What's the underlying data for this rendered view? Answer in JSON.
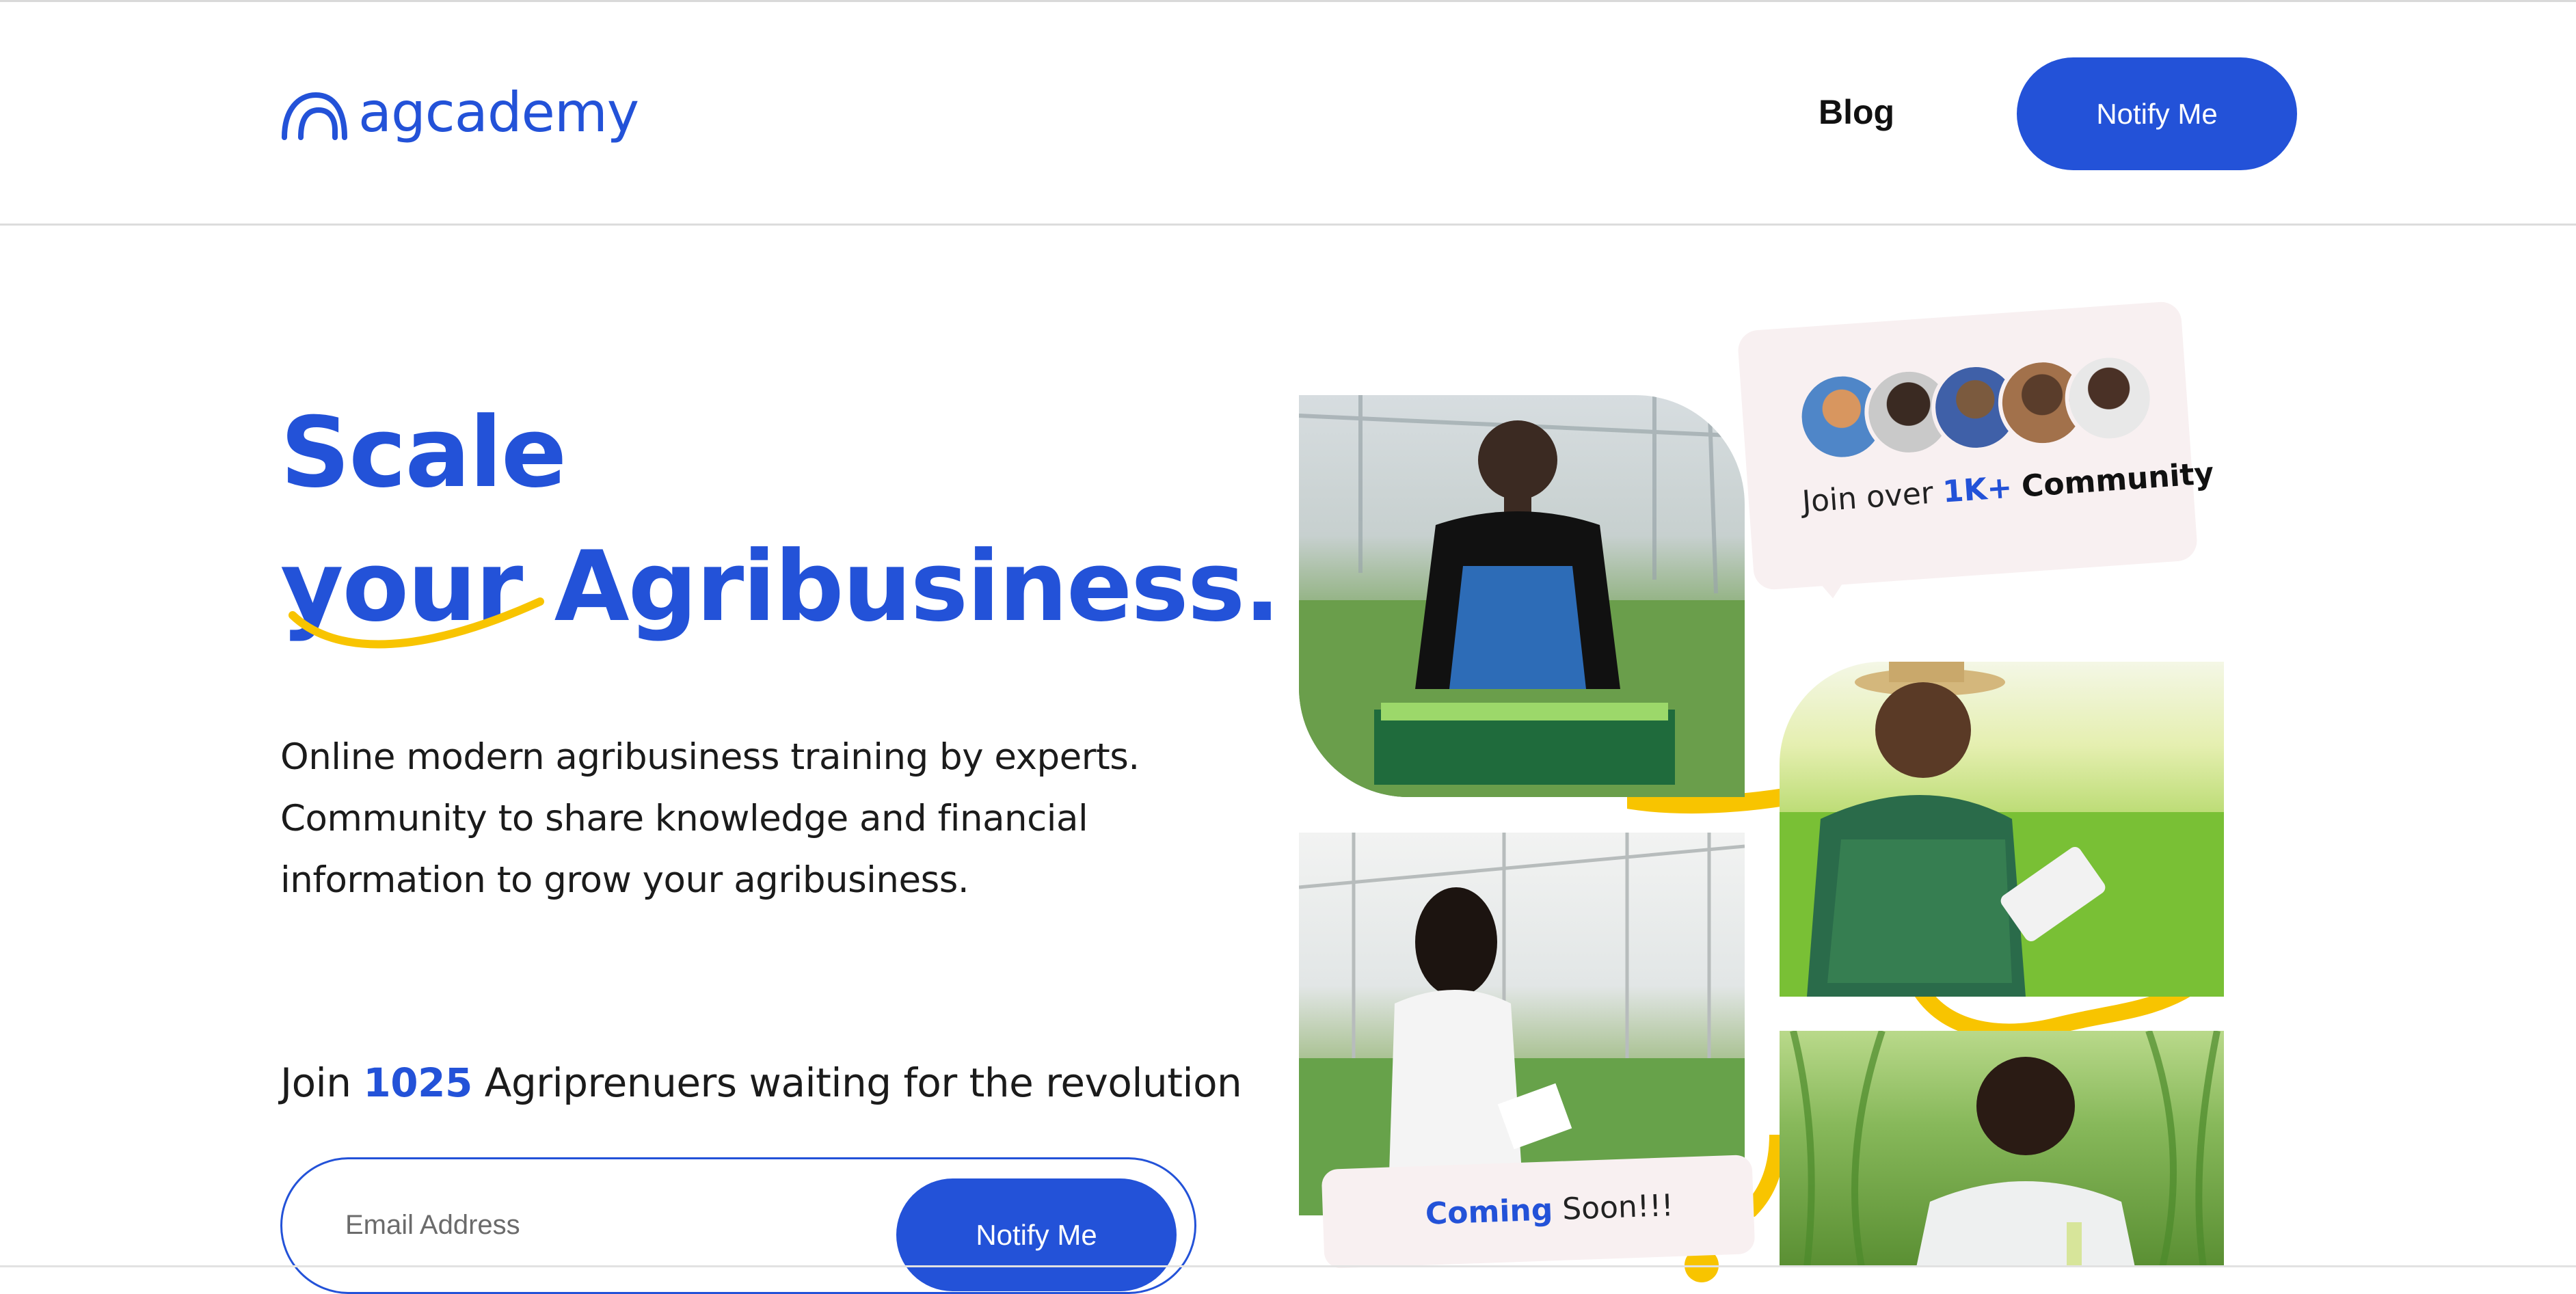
{
  "header": {
    "logo_text": "agcademy",
    "nav": {
      "blog_label": "Blog",
      "notify_label": "Notify Me"
    }
  },
  "hero": {
    "title_line1": "Scale",
    "title_line2_part1": "your",
    "title_line2_part2": "Agribusiness.",
    "description_lines": [
      "Online modern agribusiness training by experts.",
      "Community to share knowledge and financial",
      "information to grow your agribusiness."
    ],
    "join_prefix": "Join",
    "join_count": "1025",
    "join_suffix": "Agriprenuers waiting for the revolution",
    "email_placeholder": "Email Address",
    "submit_label": "Notify Me"
  },
  "collage": {
    "community_prefix": "Join over",
    "community_count": "1K+",
    "community_suffix": "Community",
    "coming_highlight": "Coming",
    "coming_rest": "Soon!!!"
  },
  "colors": {
    "brand_blue": "#2352d8",
    "accent_yellow": "#f8c400",
    "card_pink": "#f8f0f1"
  },
  "icons": {
    "logo": "agcademy-logo-icon"
  }
}
